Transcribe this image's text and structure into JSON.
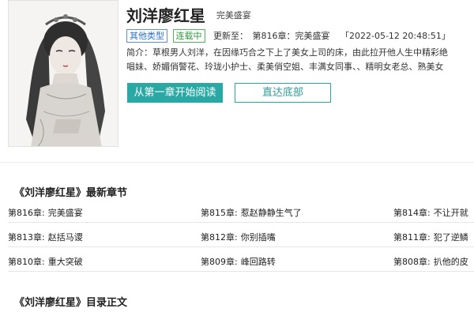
{
  "book": {
    "title": "刘洋廖红星",
    "latest_inline": "完美盛宴",
    "tags": [
      "其他类型",
      "连载中"
    ],
    "update_label": "更新至：",
    "update_chapter": "第816章：完美盛宴",
    "update_time": "「2022-05-12 20:48:51」",
    "intro_lines": [
      "简介：草根男人刘洋，在因缘巧合之下上了美女上司的床，由此拉开他人生中精彩绝",
      "唱妹、娇媚俏警花、玲珑小护士、柔美俏空姐、丰满女同事、、精明女老总、熟美女"
    ]
  },
  "buttons": {
    "read_first": "从第一章开始阅读",
    "go_bottom": "直达底部"
  },
  "sections": {
    "latest_title": "《刘洋廖红星》最新章节",
    "toc_title": "《刘洋廖红星》目录正文"
  },
  "latest_chapters": [
    [
      {
        "num": "第816章:",
        "name": "完美盛宴"
      },
      {
        "num": "第815章:",
        "name": "惹赵静静生气了"
      },
      {
        "num": "第814章:",
        "name": "不让开就"
      }
    ],
    [
      {
        "num": "第813章:",
        "name": "赵括马谡"
      },
      {
        "num": "第812章:",
        "name": "你别插嘴"
      },
      {
        "num": "第811章:",
        "name": "犯了逆鳞"
      }
    ],
    [
      {
        "num": "第810章:",
        "name": "重大突破"
      },
      {
        "num": "第809章:",
        "name": "峰回路转"
      },
      {
        "num": "第808章:",
        "name": "扒他的皮"
      }
    ]
  ],
  "colors": {
    "accent": "#2aa8a3",
    "tag_blue": "#2a6fd6",
    "tag_green": "#2e9a3a"
  }
}
